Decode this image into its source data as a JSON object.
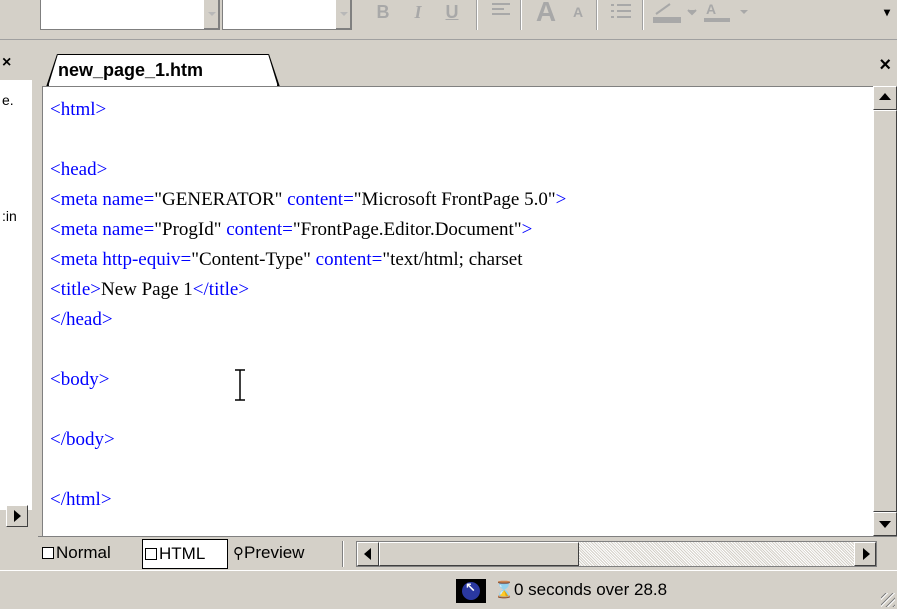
{
  "toolbar": {
    "buttons": [
      "bold-button",
      "italic-button",
      "underline-button",
      "align-button",
      "grow-font-button",
      "shrink-font-button",
      "list-button",
      "highlight-button",
      "font-color-button"
    ],
    "bold_label": "B",
    "italic_label": "I",
    "underline_label": "U"
  },
  "left_pane": {
    "close_label": "×",
    "fragments": [
      "e.",
      ":in"
    ]
  },
  "document": {
    "tab_title": "new_page_1.htm",
    "close_label": "×",
    "code_lines": [
      [
        {
          "c": "tag",
          "t": "<html>"
        }
      ],
      [],
      [
        {
          "c": "tag",
          "t": "<head>"
        }
      ],
      [
        {
          "c": "tag",
          "t": "<meta "
        },
        {
          "c": "aname",
          "t": "name="
        },
        {
          "c": "aval",
          "t": "\"GENERATOR\" "
        },
        {
          "c": "aname",
          "t": "content="
        },
        {
          "c": "aval",
          "t": "\"Microsoft FrontPage 5.0\""
        },
        {
          "c": "tag",
          "t": ">"
        }
      ],
      [
        {
          "c": "tag",
          "t": "<meta "
        },
        {
          "c": "aname",
          "t": "name="
        },
        {
          "c": "aval",
          "t": "\"ProgId\" "
        },
        {
          "c": "aname",
          "t": "content="
        },
        {
          "c": "aval",
          "t": "\"FrontPage.Editor.Document\""
        },
        {
          "c": "tag",
          "t": ">"
        }
      ],
      [
        {
          "c": "tag",
          "t": "<meta "
        },
        {
          "c": "aname",
          "t": "http-equiv="
        },
        {
          "c": "aval",
          "t": "\"Content-Type\" "
        },
        {
          "c": "aname",
          "t": "content="
        },
        {
          "c": "aval",
          "t": "\"text/html; charset"
        }
      ],
      [
        {
          "c": "tag",
          "t": "<title>"
        },
        {
          "c": "txt",
          "t": "New Page 1"
        },
        {
          "c": "tag",
          "t": "</title>"
        }
      ],
      [
        {
          "c": "tag",
          "t": "</head>"
        }
      ],
      [],
      [
        {
          "c": "tag",
          "t": "<body>"
        }
      ],
      [],
      [
        {
          "c": "tag",
          "t": "</body>"
        }
      ],
      [],
      [
        {
          "c": "tag",
          "t": "</html>"
        }
      ]
    ]
  },
  "view_tabs": {
    "normal": "Normal",
    "html": "HTML",
    "preview": "Preview",
    "active": "HTML"
  },
  "status": {
    "download_time": "0 seconds over 28.8"
  },
  "colors": {
    "tag": "#0000ff",
    "text": "#000000",
    "chrome": "#d4d0c8"
  }
}
